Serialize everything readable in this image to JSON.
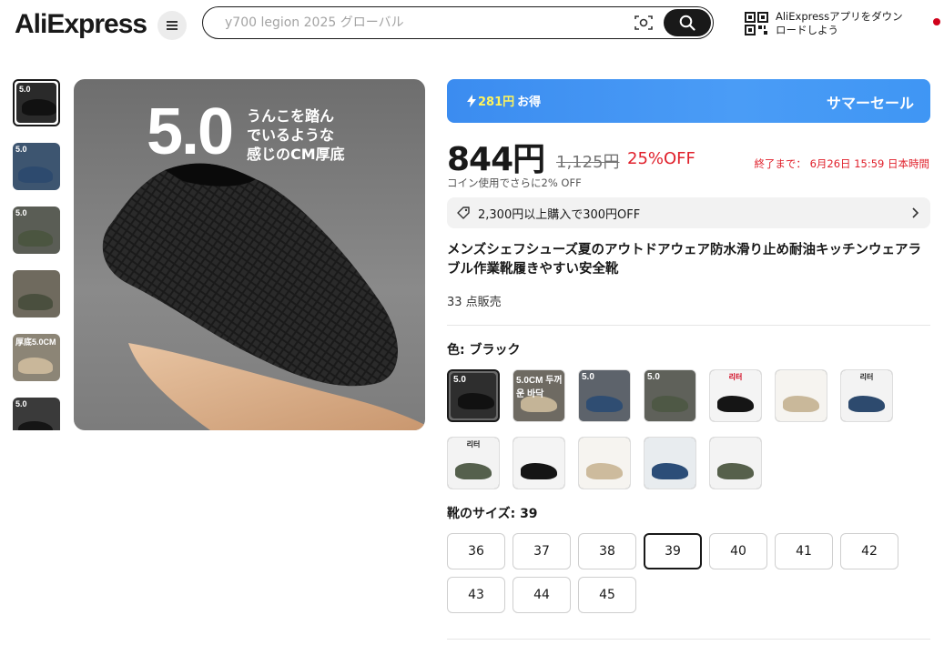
{
  "header": {
    "logo_text": "AliExpress",
    "search_placeholder": "y700 legion 2025 グローバル",
    "app_promo_line1": "AliExpressアプリをダウン",
    "app_promo_line2": "ロードしよう"
  },
  "gallery": {
    "thumbnails": [
      {
        "label": "5.0",
        "color": "#2a2a2a",
        "shoe": "#111111"
      },
      {
        "label": "5.0",
        "color": "#3d5570",
        "shoe": "#2d4a6e"
      },
      {
        "label": "5.0",
        "color": "#5a5d55",
        "shoe": "#4b5540"
      },
      {
        "label": "",
        "color": "#6f6a5e",
        "shoe": "#4a4f3e"
      },
      {
        "label": "厚底5.0CM",
        "color": "#8c8576",
        "shoe": "#c9b79a"
      },
      {
        "label": "5.0",
        "color": "#3a3a3a",
        "shoe": "#151515"
      }
    ],
    "main_headline": "5.0",
    "main_caption_1": "うんこを踏ん",
    "main_caption_2": "でいるような",
    "main_caption_3": "感じのCM厚底"
  },
  "promo": {
    "coin_amount": "281円",
    "coin_suffix": "お得",
    "sale_label": "サマーセール"
  },
  "pricing": {
    "price": "844円",
    "original_price": "1,125円",
    "discount": "25%OFF",
    "ends_label": "終了まで：",
    "ends_value": "6月26日 15:59 日本時間",
    "coin_note": "コイン使用でさらに2% OFF"
  },
  "coupon": {
    "text": "2,300円以上購入で300円OFF"
  },
  "product": {
    "title": "メンズシェフシューズ夏のアウトドアウェア防水滑り止め耐油キッチンウェアラブル作業靴履きやすい安全靴",
    "sold": "33 点販売"
  },
  "color": {
    "label_prefix": "色: ",
    "selected": "ブラック",
    "options": [
      {
        "tag": "5.0",
        "tag_style": "white",
        "bg": "#2e2e2e",
        "shoe": "#111111"
      },
      {
        "tag": "5.0CM 두꺼운 바닥",
        "tag_style": "white",
        "bg": "#6e6a62",
        "shoe": "#c4b497"
      },
      {
        "tag": "5.0",
        "tag_style": "white",
        "bg": "#5d636b",
        "shoe": "#2f4d72"
      },
      {
        "tag": "5.0",
        "tag_style": "white",
        "bg": "#5f615a",
        "shoe": "#4e5845"
      },
      {
        "tag": "리터",
        "tag_style": "red",
        "bg": "#f4f4f4",
        "shoe": "#151515"
      },
      {
        "tag": "",
        "tag_style": "red",
        "bg": "#f6f4f0",
        "shoe": "#c9b89a"
      },
      {
        "tag": "리터",
        "tag_style": "dark",
        "bg": "#f3f3f3",
        "shoe": "#2d4a6e"
      },
      {
        "tag": "리터",
        "tag_style": "dark",
        "bg": "#f3f3f3",
        "shoe": "#55604d"
      },
      {
        "tag": "",
        "tag_style": "dark",
        "bg": "#f4f4f4",
        "shoe": "#151515"
      },
      {
        "tag": "",
        "tag_style": "dark",
        "bg": "#f6f4f0",
        "shoe": "#cdbb9d"
      },
      {
        "tag": "",
        "tag_style": "dark",
        "bg": "#e8ecef",
        "shoe": "#2b4d78"
      },
      {
        "tag": "",
        "tag_style": "dark",
        "bg": "#f3f3f3",
        "shoe": "#56604b"
      }
    ]
  },
  "size": {
    "label_prefix": "靴のサイズ: ",
    "selected": "39",
    "options": [
      "36",
      "37",
      "38",
      "39",
      "40",
      "41",
      "42",
      "43",
      "44",
      "45"
    ]
  },
  "colors": {
    "accent_red": "#e0202b",
    "banner_blue": "#4a9cf6",
    "coin_yellow": "#fff45c"
  }
}
